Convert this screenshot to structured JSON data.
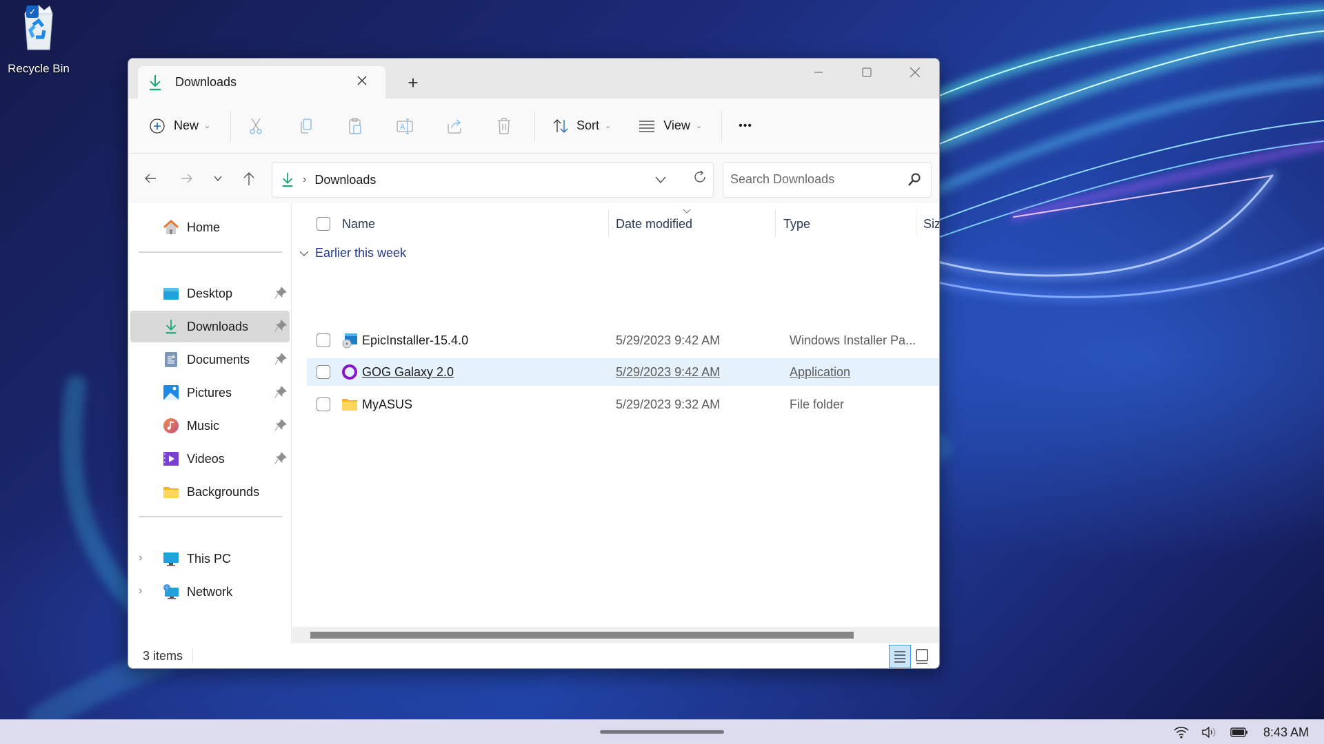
{
  "desktop": {
    "icons": [
      {
        "label": "Recycle Bin",
        "icon": "recycle-bin-icon",
        "selected": true
      }
    ]
  },
  "window": {
    "tabs": [
      {
        "title": "Downloads",
        "icon": "download-icon",
        "active": true
      }
    ],
    "new_tab_label": "+",
    "controls": {
      "minimize": "minimize-icon",
      "maximize": "maximize-icon",
      "close": "close-icon"
    }
  },
  "toolbar": {
    "new_label": "New",
    "sort_label": "Sort",
    "view_label": "View",
    "more_label": "•••",
    "actions": [
      "cut",
      "copy",
      "paste",
      "rename",
      "share",
      "delete"
    ]
  },
  "address": {
    "path": [
      "Downloads"
    ],
    "search_placeholder": "Search Downloads"
  },
  "sidebar": {
    "home": {
      "label": "Home"
    },
    "quick_access": [
      {
        "label": "Desktop",
        "icon": "desktop-icon",
        "pinned": true
      },
      {
        "label": "Downloads",
        "icon": "download-icon",
        "pinned": true,
        "selected": true
      },
      {
        "label": "Documents",
        "icon": "documents-icon",
        "pinned": true
      },
      {
        "label": "Pictures",
        "icon": "pictures-icon",
        "pinned": true
      },
      {
        "label": "Music",
        "icon": "music-icon",
        "pinned": true
      },
      {
        "label": "Videos",
        "icon": "videos-icon",
        "pinned": true
      },
      {
        "label": "Backgrounds",
        "icon": "folder-icon",
        "pinned": false
      }
    ],
    "locations": [
      {
        "label": "This PC",
        "icon": "this-pc-icon"
      },
      {
        "label": "Network",
        "icon": "network-icon"
      }
    ]
  },
  "content": {
    "columns": [
      "Name",
      "Date modified",
      "Type",
      "Size"
    ],
    "sort_column": "Date modified",
    "sort_direction": "descending",
    "groups": [
      {
        "label": "Earlier this week",
        "files": [
          {
            "name": "EpicInstaller-15.4.0",
            "date": "5/29/2023 9:42 AM",
            "type": "Windows Installer Pa...",
            "icon": "installer-icon"
          },
          {
            "name": "GOG Galaxy 2.0",
            "date": "5/29/2023 9:42 AM",
            "type": "Application",
            "icon": "gog-galaxy-icon",
            "hovered": true
          },
          {
            "name": "MyASUS",
            "date": "5/29/2023 9:32 AM",
            "type": "File folder",
            "icon": "folder-icon"
          }
        ]
      }
    ]
  },
  "status": {
    "item_count": "3 items",
    "view_mode": "details"
  },
  "taskbar": {
    "time": "8:43 AM",
    "tray_icons": [
      "wifi-icon",
      "volume-icon",
      "battery-icon"
    ]
  }
}
